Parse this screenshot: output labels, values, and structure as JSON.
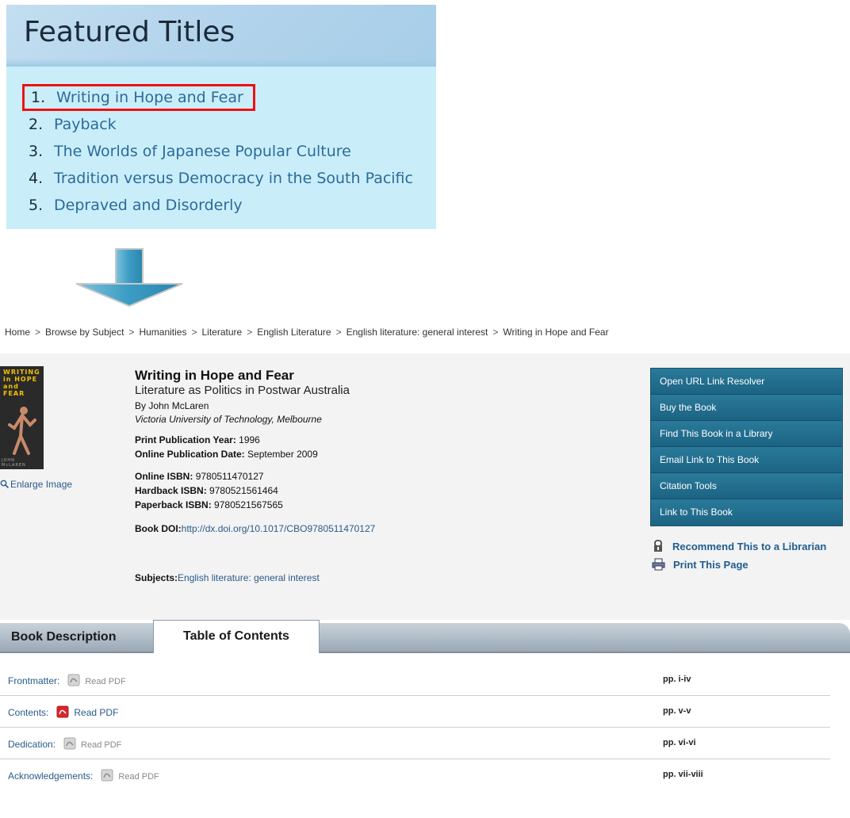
{
  "featured": {
    "title": "Featured Titles",
    "items": [
      {
        "num": "1.",
        "label": "Writing in Hope and Fear",
        "highlighted": true
      },
      {
        "num": "2.",
        "label": "Payback"
      },
      {
        "num": "3.",
        "label": "The Worlds of Japanese Popular Culture"
      },
      {
        "num": "4.",
        "label": "Tradition versus Democracy in the South Pacific"
      },
      {
        "num": "5.",
        "label": "Depraved and Disorderly"
      }
    ],
    "highlight_color": "#e11111"
  },
  "breadcrumb": {
    "separator": ">",
    "items": [
      "Home",
      "Browse by Subject",
      "Humanities",
      "Literature",
      "English Literature",
      "English literature: general interest",
      "Writing in Hope and Fear"
    ]
  },
  "cover": {
    "title_lines": [
      "WRITING",
      "in HOPE",
      "and",
      "FEAR"
    ],
    "author": "JOHN McLAREN"
  },
  "enlarge_label": "Enlarge Image",
  "book": {
    "title": "Writing in Hope and Fear",
    "subtitle": "Literature as Politics in Postwar Australia",
    "author": "By John McLaren",
    "affiliation": "Victoria University of Technology, Melbourne",
    "print_year_label": "Print Publication Year:",
    "print_year": "1996",
    "online_date_label": "Online Publication Date:",
    "online_date": "September 2009",
    "online_isbn_label": "Online ISBN:",
    "online_isbn": "9780511470127",
    "hardback_isbn_label": "Hardback ISBN:",
    "hardback_isbn": "9780521561464",
    "paperback_isbn_label": "Paperback ISBN:",
    "paperback_isbn": "9780521567565",
    "doi_label": "Book DOI:",
    "doi": "http://dx.doi.org/10.1017/CBO9780511470127",
    "subjects_label": "Subjects:",
    "subjects": "English literature: general interest"
  },
  "actions": [
    "Open URL Link Resolver",
    "Buy the Book",
    "Find This Book in a Library",
    "Email Link to This Book",
    "Citation Tools",
    "Link to This Book"
  ],
  "side_links": {
    "recommend": {
      "label": "Recommend This to a Librarian",
      "icon": "librarian-icon"
    },
    "print": {
      "label": "Print This Page",
      "icon": "printer-icon"
    }
  },
  "tabs": {
    "description": "Book Description",
    "contents": "Table of Contents",
    "active": "Table of Contents"
  },
  "toc": [
    {
      "label": "Frontmatter:",
      "read": "Read PDF",
      "pages": "pp. i-iv",
      "active": false
    },
    {
      "label": "Contents:",
      "read": "Read PDF",
      "pages": "pp. v-v",
      "active": true
    },
    {
      "label": "Dedication:",
      "read": "Read PDF",
      "pages": "pp. vi-vi",
      "active": false
    },
    {
      "label": "Acknowledgements:",
      "read": "Read PDF",
      "pages": "pp. vii-viii",
      "active": false
    }
  ],
  "colors": {
    "featured_bg": "#c9eefa",
    "action_button": "#1f6a8a",
    "link": "#2a5a8a",
    "pdf_active": "#d9262c"
  }
}
